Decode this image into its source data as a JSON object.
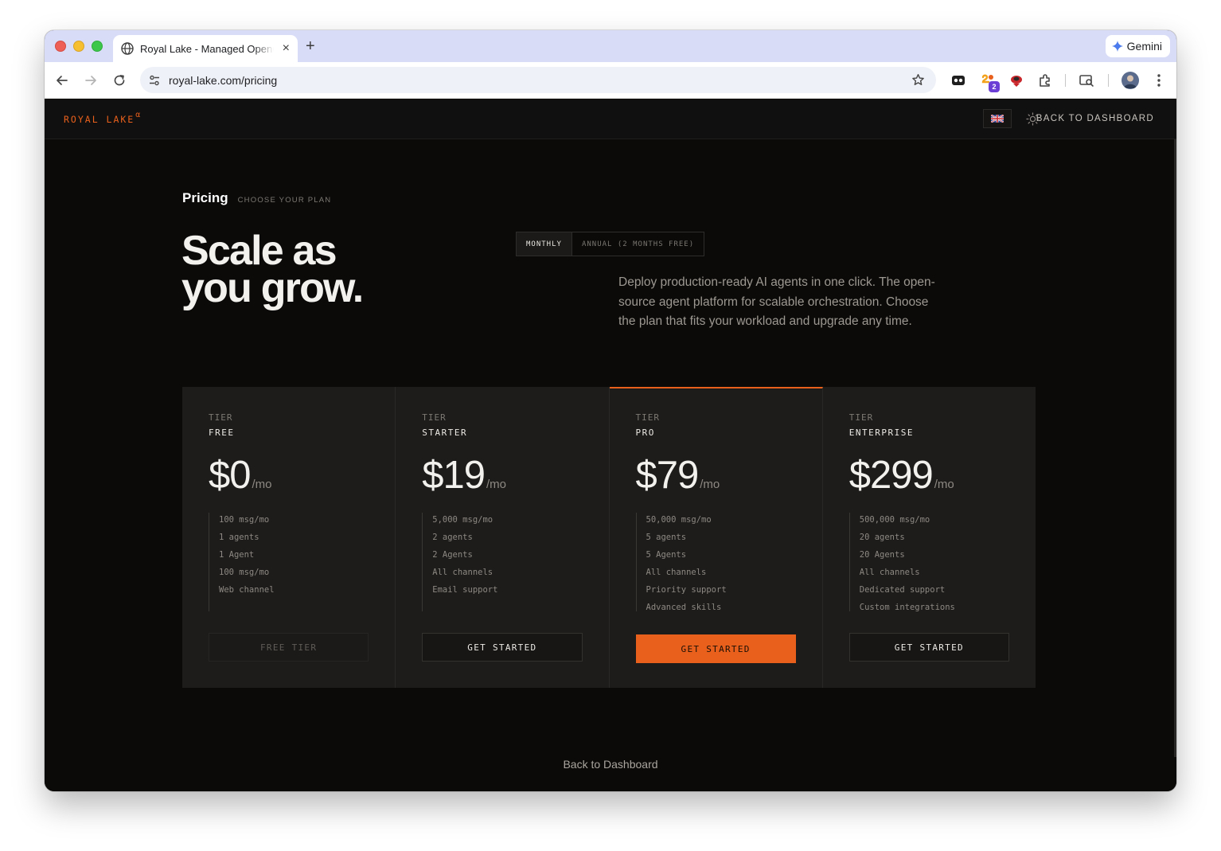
{
  "browser": {
    "tab_title": "Royal Lake - Managed OpenClaw",
    "new_tab_label": "+",
    "tab_close_label": "×",
    "url": "royal-lake.com/pricing",
    "gemini_label": "Gemini",
    "extension_badge": "2",
    "icons": [
      "globe-icon",
      "back-icon",
      "forward-icon",
      "reload-icon",
      "site-settings-icon",
      "star-icon",
      "extensions-icon",
      "profile-avatar",
      "menu-icon"
    ]
  },
  "header": {
    "logo_text": "ROYAL LAKE",
    "logo_sup": "α",
    "language_flag": "🇬🇧",
    "back_label": "BACK TO DASHBOARD"
  },
  "page": {
    "title": "Pricing",
    "subtitle": "CHOOSE YOUR PLAN"
  },
  "billing_toggle": {
    "monthly_label": "MONTHLY",
    "annual_label": "ANNUAL (2 MONTHS FREE)",
    "selected": "monthly"
  },
  "hero": {
    "title_line1": "Scale as",
    "title_line2": "you grow.",
    "description": "Deploy production-ready AI agents in one click. The open-source agent platform for scalable orchestration. Choose the plan that fits your workload and upgrade any time."
  },
  "plans": [
    {
      "tier_label": "TIER",
      "name": "FREE",
      "price": "$0",
      "period": "/mo",
      "features": [
        "100 msg/mo",
        "1 agents",
        "1 Agent",
        "100 msg/mo",
        "Web channel"
      ],
      "cta": "FREE TIER"
    },
    {
      "tier_label": "TIER",
      "name": "STARTER",
      "price": "$19",
      "period": "/mo",
      "features": [
        "5,000 msg/mo",
        "2 agents",
        "2 Agents",
        "All channels",
        "Email support"
      ],
      "cta": "GET STARTED"
    },
    {
      "tier_label": "TIER",
      "name": "PRO",
      "price": "$79",
      "period": "/mo",
      "features": [
        "50,000 msg/mo",
        "5 agents",
        "5 Agents",
        "All channels",
        "Priority support",
        "Advanced skills"
      ],
      "cta": "GET STARTED"
    },
    {
      "tier_label": "TIER",
      "name": "ENTERPRISE",
      "price": "$299",
      "period": "/mo",
      "features": [
        "500,000 msg/mo",
        "20 agents",
        "20 Agents",
        "All channels",
        "Dedicated support",
        "Custom integrations"
      ],
      "cta": "GET STARTED"
    }
  ],
  "footer": {
    "back_label": "Back to Dashboard"
  },
  "colors": {
    "accent": "#e8601c",
    "background": "#0b0a09",
    "card": "#1d1c1b"
  }
}
